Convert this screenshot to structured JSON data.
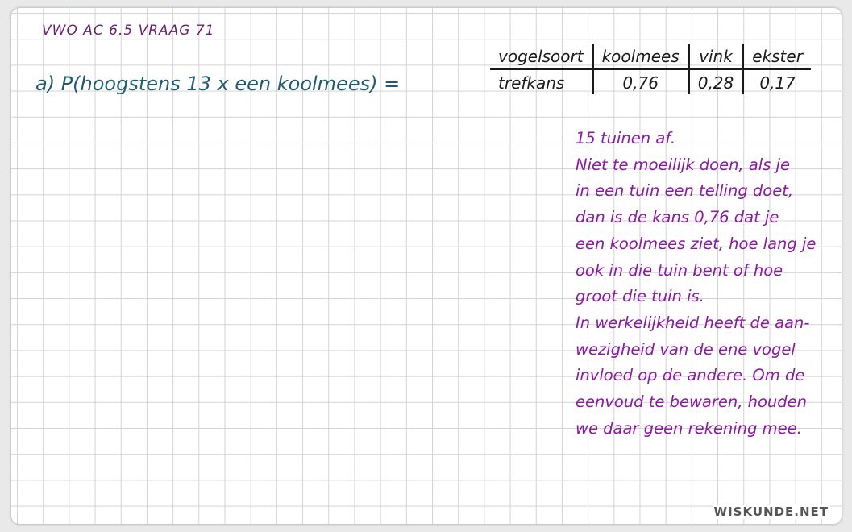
{
  "header": {
    "text": "VWO AC 6.5 VRAAG 71"
  },
  "question": {
    "text": "a) P(hoogstens 13 x een koolmees) ="
  },
  "table": {
    "row_headers": [
      "vogelsoort",
      "trefkans"
    ],
    "columns": [
      "koolmees",
      "vink",
      "ekster"
    ],
    "values": [
      "0,76",
      "0,28",
      "0,17"
    ]
  },
  "note": {
    "lines": [
      "15 tuinen af.",
      "Niet te moeilijk doen, als je",
      "in een tuin een telling doet,",
      "dan is de kans 0,76 dat je",
      "een koolmees ziet, hoe lang je",
      "ook in die tuin bent of hoe",
      "groot die tuin is.",
      "In werkelijkheid heeft de aan-",
      "wezigheid van de ene vogel",
      "invloed op de andere. Om de",
      "eenvoud te bewaren, houden",
      "we daar geen rekening mee."
    ]
  },
  "brand": {
    "logo": "WISKUNDE.NET"
  },
  "colors": {
    "header": "#6a1e6a",
    "question": "#1f5c70",
    "table": "#1a1a1a",
    "note": "#8a1aa0",
    "grid": "#d3d3d3"
  }
}
